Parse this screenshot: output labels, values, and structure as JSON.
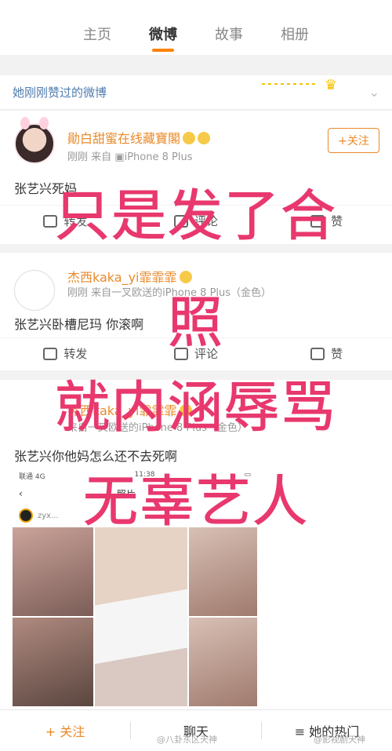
{
  "tabs": [
    "主页",
    "微博",
    "故事",
    "相册"
  ],
  "liked_header": "她刚刚赞过的微博",
  "posts": [
    {
      "name": "勛白甜蜜在线藏寶閣",
      "time": "刚刚",
      "source": "来自",
      "device": "iPhone 8 Plus",
      "follow": "+关注",
      "text": "张艺兴死妈",
      "actions": [
        "转发",
        "评论",
        "赞"
      ]
    },
    {
      "name": "杰西kaka_yi霏霏霏",
      "time": "刚刚",
      "source": "来自一叉欧送的iPhone 8 Plus（金色）",
      "text": "张艺兴卧槽尼玛 你滚啊",
      "actions": [
        "转发",
        "评论",
        "赞"
      ]
    },
    {
      "name": "杰西kaka_yi霏霏霏",
      "source": "来自一叉欧送的iPhone 8 Plus（金色）",
      "text": "张艺兴你他妈怎么还不去死啊",
      "embedded": {
        "carrier": "联通 4G",
        "clock": "11:38",
        "title": "照片",
        "user": "zyx..."
      }
    }
  ],
  "overlay": [
    "只是发了合",
    "照",
    "就内涵辱骂",
    "无辜艺人"
  ],
  "bottom_bar": {
    "follow": "+ 关注",
    "chat": "聊天",
    "hot": "≡ 她的热门"
  },
  "watermarks": [
    "@八卦东区天神",
    "@影视剧天神"
  ],
  "colors": {
    "accent": "#ff8200",
    "overlay": "#e8386e",
    "link": "#507daf"
  }
}
